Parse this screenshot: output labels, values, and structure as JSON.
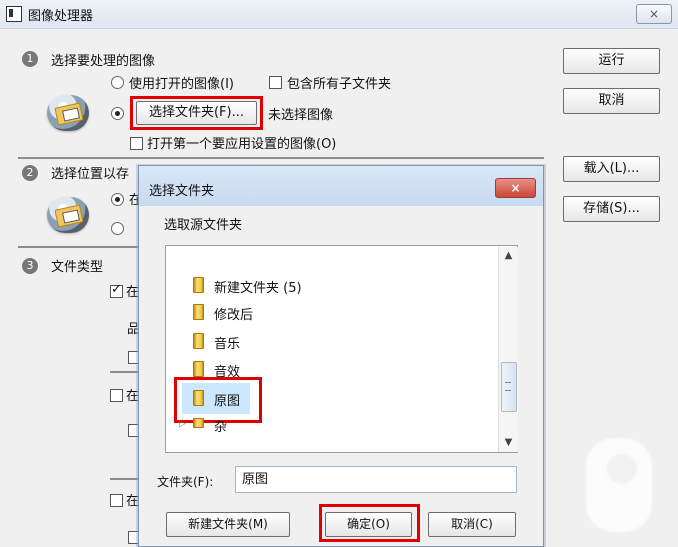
{
  "window": {
    "title": "图像处理器",
    "close": "×"
  },
  "section1": {
    "number": "1",
    "title": "选择要处理的图像",
    "use_open_images": "使用打开的图像(I)",
    "include_subfolders": "包含所有子文件夹",
    "select_folder_button": "选择文件夹(F)...",
    "no_image_selected": "未选择图像",
    "open_first_image": "打开第一个要应用设置的图像(O)"
  },
  "section2": {
    "number": "2",
    "title": "选择位置以存",
    "option1_fragment": "在",
    "option2_fragment": ""
  },
  "section3": {
    "number": "3",
    "title": "文件类型",
    "fragments": [
      "在",
      "品",
      "在",
      "在"
    ]
  },
  "side_buttons": {
    "run": "运行",
    "cancel": "取消",
    "load": "载入(L)...",
    "save": "存储(S)..."
  },
  "dialog": {
    "title": "选择文件夹",
    "close": "×",
    "prompt": "选取源文件夹",
    "folders": [
      {
        "label": "新建文件夹 (5)"
      },
      {
        "label": "修改后"
      },
      {
        "label": "音乐"
      },
      {
        "label": "音效"
      },
      {
        "label": "原图"
      },
      {
        "label": "杂"
      }
    ],
    "folder_label": "文件夹(F):",
    "folder_value": "原图",
    "new_folder": "新建文件夹(M)",
    "ok": "确定(O)",
    "cancel": "取消(C)"
  },
  "colors": {
    "highlight_red": "#e10000"
  }
}
